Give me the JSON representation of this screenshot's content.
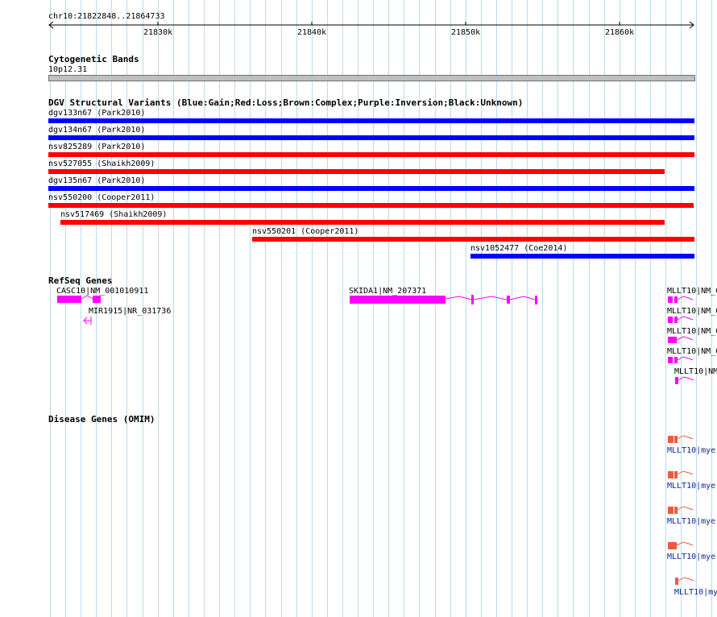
{
  "ruler": {
    "location": "chr10:21822848..21864733",
    "ticks": [
      "21830k",
      "21840k",
      "21850k",
      "21860k"
    ]
  },
  "tracks": {
    "cytobands": {
      "title": "Cytogenetic Bands",
      "band": "10p12.31"
    },
    "dgv": {
      "title": "DGV Structural Variants (Blue:Gain;Red:Loss;Brown:Complex;Purple:Inversion;Black:Unknown)",
      "variants": [
        {
          "label": "dgv133n67 (Park2010)",
          "type": "gain"
        },
        {
          "label": "dgv134n67 (Park2010)",
          "type": "gain"
        },
        {
          "label": "nsv825289 (Park2010)",
          "type": "loss"
        },
        {
          "label": "nsv527055 (Shaikh2009)",
          "type": "loss"
        },
        {
          "label": "dgv135n67 (Park2010)",
          "type": "gain"
        },
        {
          "label": "nsv550200 (Cooper2011)",
          "type": "loss"
        },
        {
          "label": "nsv517469 (Shaikh2009)",
          "type": "loss"
        },
        {
          "label": "nsv550201 (Cooper2011)",
          "type": "loss"
        },
        {
          "label": "nsv1052477 (Coe2014)",
          "type": "gain"
        }
      ]
    },
    "refseq": {
      "title": "RefSeq Genes",
      "genes": [
        {
          "label": "CASC10|NM_001010911"
        },
        {
          "label": "MIR1915|NR_031736"
        },
        {
          "label": "SKIDA1|NM_207371"
        },
        {
          "label": "MLLT10|NM_0"
        },
        {
          "label": "MLLT10|NM_0"
        },
        {
          "label": "MLLT10|NM_0"
        },
        {
          "label": "MLLT10|NM_0"
        },
        {
          "label": "MLLT10|NM"
        }
      ]
    },
    "omim": {
      "title": "Disease Genes (OMIM)",
      "genes": [
        {
          "label": "MLLT10|mye"
        },
        {
          "label": "MLLT10|mye"
        },
        {
          "label": "MLLT10|mye"
        },
        {
          "label": "MLLT10|mye"
        },
        {
          "label": "MLLT10|my"
        }
      ]
    }
  },
  "colors": {
    "gain": "#0000ff",
    "loss": "#ff0000",
    "refseq_gene": "#ff00ff",
    "omim_gene": "#f05a3c",
    "grid": "#b8dcec",
    "band": "#c0c0c0"
  }
}
